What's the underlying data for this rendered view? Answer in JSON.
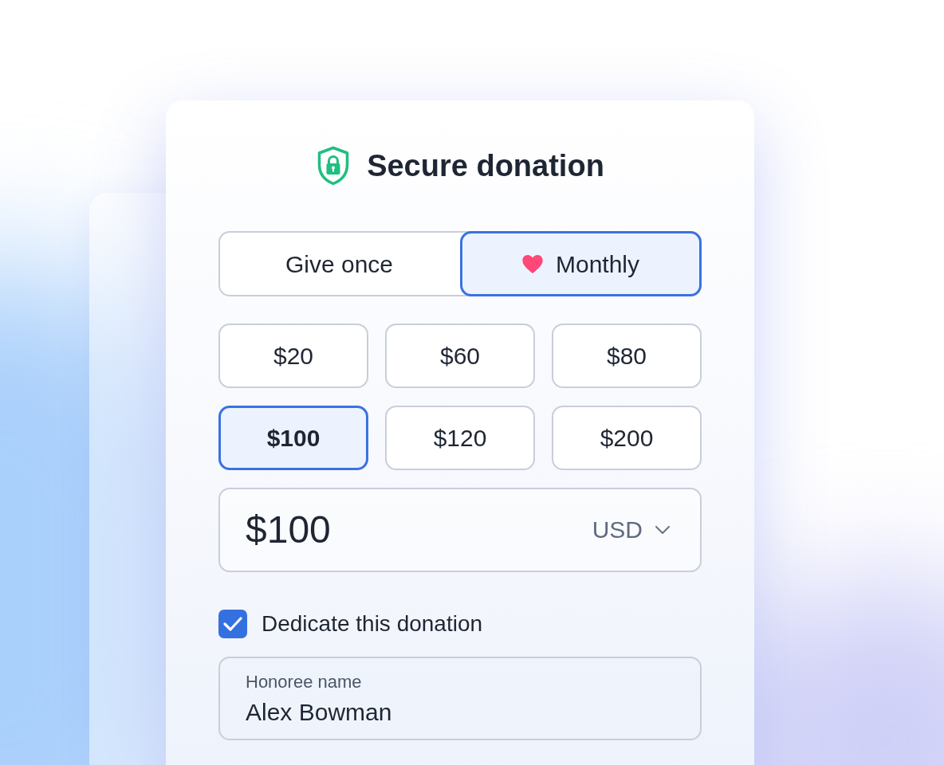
{
  "header": {
    "title": "Secure donation"
  },
  "frequency_tabs": [
    {
      "label": "Give once",
      "kind": "once",
      "selected": false
    },
    {
      "label": "Monthly",
      "kind": "recurring",
      "selected": true
    }
  ],
  "amount_options": [
    {
      "label": "$20",
      "selected": false
    },
    {
      "label": "$60",
      "selected": false
    },
    {
      "label": "$80",
      "selected": false
    },
    {
      "label": "$100",
      "selected": true
    },
    {
      "label": "$120",
      "selected": false
    },
    {
      "label": "$200",
      "selected": false
    }
  ],
  "amount_field": {
    "value": "$100",
    "currency": "USD"
  },
  "dedication": {
    "label": "Dedicate this donation",
    "checked": true
  },
  "honoree_field": {
    "label": "Honoree name",
    "value": "Alex Bowman"
  }
}
